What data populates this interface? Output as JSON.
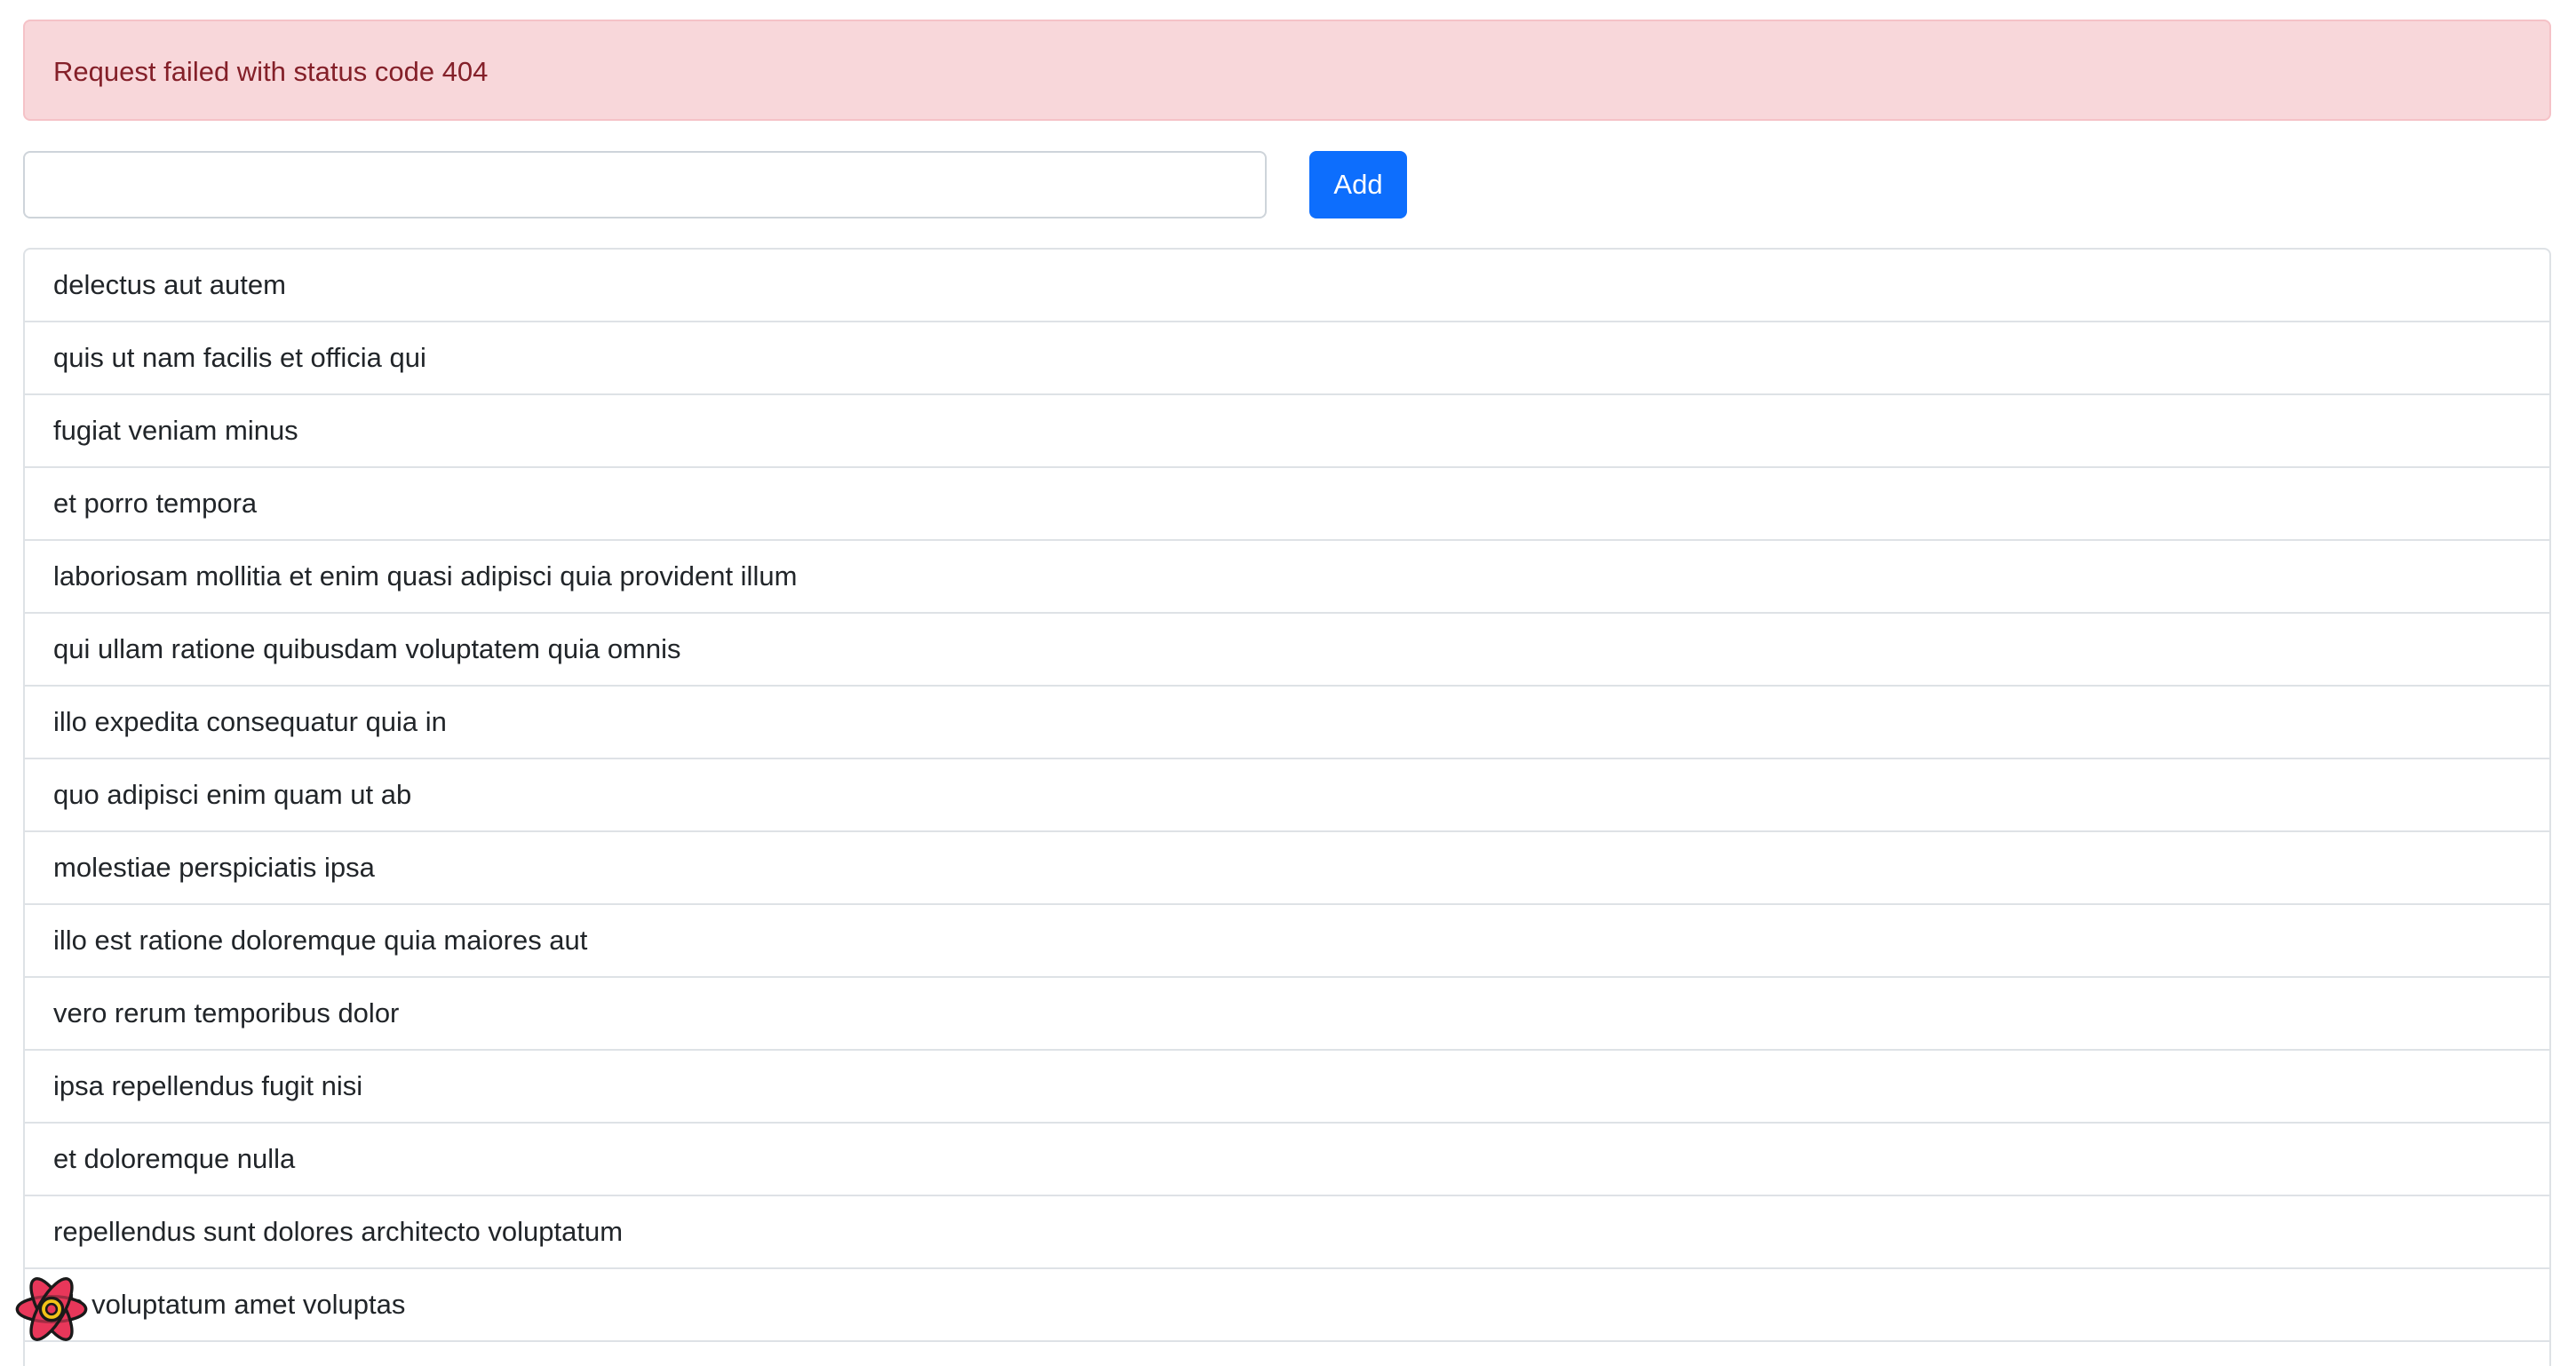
{
  "alert": {
    "message": "Request failed with status code 404"
  },
  "form": {
    "input_value": "",
    "add_label": "Add"
  },
  "items": [
    "delectus aut autem",
    "quis ut nam facilis et officia qui",
    "fugiat veniam minus",
    "et porro tempora",
    "laboriosam mollitia et enim quasi adipisci quia provident illum",
    "qui ullam ratione quibusdam voluptatem quia omnis",
    "illo expedita consequatur quia in",
    "quo adipisci enim quam ut ab",
    "molestiae perspiciatis ipsa",
    "illo est ratione doloremque quia maiores aut",
    "vero rerum temporibus dolor",
    "ipsa repellendus fugit nisi",
    "et doloremque nulla",
    "repellendus sunt dolores architecto voluptatum",
    "ab voluptatum amet voluptas"
  ],
  "overlay": {
    "icon": "react-devtools-icon",
    "colors": {
      "fill": "#e8375a",
      "stroke": "#1a1a1a",
      "core": "#f2c318"
    }
  },
  "colors": {
    "alert_bg": "#f8d7da",
    "alert_text": "#842029",
    "primary": "#0d6efd",
    "border": "#dee2e6"
  }
}
